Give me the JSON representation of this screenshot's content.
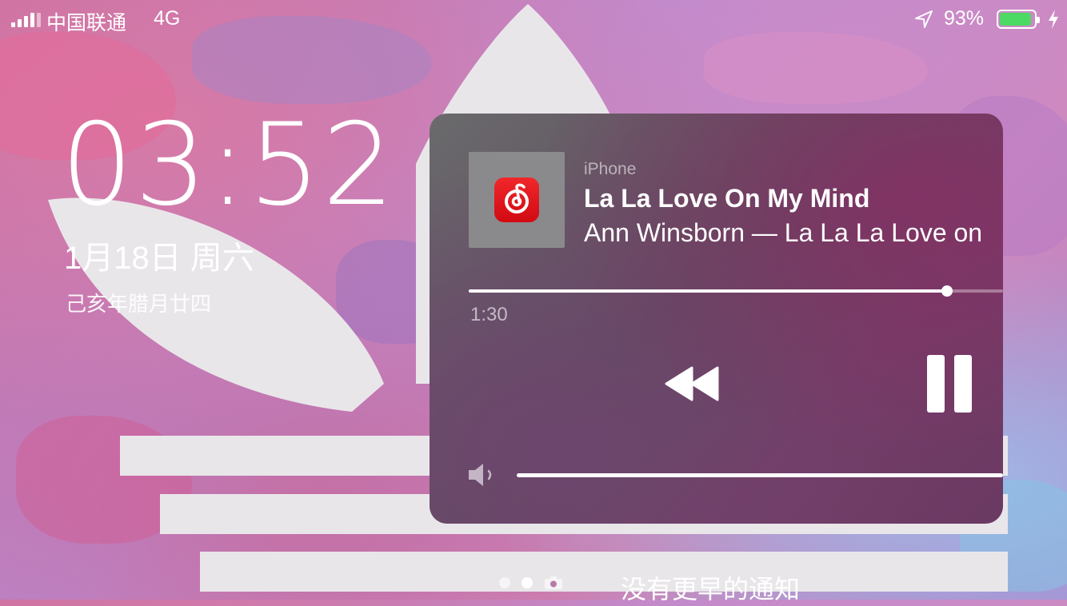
{
  "status_bar": {
    "carrier": "中国联通",
    "network": "4G",
    "battery_percent": "93%",
    "battery_level": 0.93,
    "signal_bars": 4,
    "battery_color": "#4cd964"
  },
  "lock_screen": {
    "time": "03:52",
    "date": "1月18日 周六",
    "lunar_date": "己亥年腊月廿四",
    "no_older_notifications": "没有更早的通知"
  },
  "now_playing": {
    "device": "iPhone",
    "title": "La La Love On My Mind",
    "subtitle": "Ann Winsborn — La La La Love on",
    "elapsed": "1:30",
    "progress": 0.895,
    "volume": 1.0,
    "app_icon": "netease-music-icon",
    "controls": [
      "rewind-icon",
      "pause-icon"
    ]
  },
  "page_indicator": {
    "pages": 2,
    "active": 1,
    "camera_icon": "camera-icon"
  }
}
